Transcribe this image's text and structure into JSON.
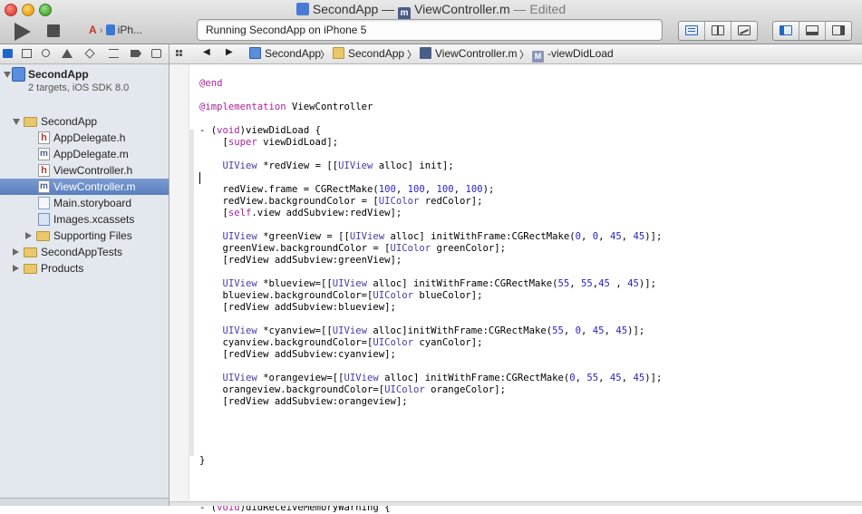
{
  "window": {
    "project_name": "SecondApp",
    "title_sep": "—",
    "file_name": "ViewController.m",
    "status": "— Edited"
  },
  "toolbar": {
    "scheme": "iPh...",
    "activity": "Running SecondApp on iPhone 5"
  },
  "navigator": {
    "project": {
      "name": "SecondApp",
      "subtitle": "2 targets, iOS SDK 8.0"
    },
    "items": [
      {
        "label": "SecondApp",
        "type": "folder"
      },
      {
        "label": "AppDelegate.h",
        "type": "h"
      },
      {
        "label": "AppDelegate.m",
        "type": "m"
      },
      {
        "label": "ViewController.h",
        "type": "h"
      },
      {
        "label": "ViewController.m",
        "type": "m"
      },
      {
        "label": "Main.storyboard",
        "type": "storyboard"
      },
      {
        "label": "Images.xcassets",
        "type": "xcassets"
      },
      {
        "label": "Supporting Files",
        "type": "folder"
      },
      {
        "label": "SecondAppTests",
        "type": "folder"
      },
      {
        "label": "Products",
        "type": "folder"
      }
    ]
  },
  "jumpbar": {
    "back_arrow": "◀",
    "forward_arrow": "▶",
    "separator": "〉",
    "crumbs": [
      "SecondApp",
      "SecondApp",
      "ViewController.m",
      "-viewDidLoad"
    ]
  },
  "code_lines": [
    "@end",
    "",
    "@implementation ViewController",
    "",
    "- (void)viewDidLoad {",
    "    [super viewDidLoad];",
    "",
    "    UIView *redView = [[UIView alloc] init];",
    "",
    "    redView.frame = CGRectMake(100, 100, 100, 100);",
    "    redView.backgroundColor = [UIColor redColor];",
    "    [self.view addSubview:redView];",
    "",
    "    UIView *greenView = [[UIView alloc] initWithFrame:CGRectMake(0, 0, 45, 45)];",
    "    greenView.backgroundColor = [UIColor greenColor];",
    "    [redView addSubview:greenView];",
    "",
    "    UIView *blueview=[[UIView alloc] initWithFrame:CGRectMake(55, 55,45 , 45)];",
    "    blueview.backgroundColor=[UIColor blueColor];",
    "    [redView addSubview:blueview];",
    "",
    "    UIView *cyanview=[[UIView alloc]initWithFrame:CGRectMake(55, 0, 45, 45)];",
    "    cyanview.backgroundColor=[UIColor cyanColor];",
    "    [redView addSubview:cyanview];",
    "",
    "    UIView *orangeview=[[UIView alloc] initWithFrame:CGRectMake(0, 55, 45, 45)];",
    "    orangeview.backgroundColor=[UIColor orangeColor];",
    "    [redView addSubview:orangeview];",
    "",
    "",
    "",
    "",
    "}",
    "",
    "",
    "",
    "- (void)didReceiveMemoryWarning {"
  ],
  "colors": {
    "keyword": "#a8239c",
    "class": "#4b39a8",
    "method": "#2d5a6b",
    "number": "#2a22c8",
    "selection": "#5a7fbf"
  }
}
